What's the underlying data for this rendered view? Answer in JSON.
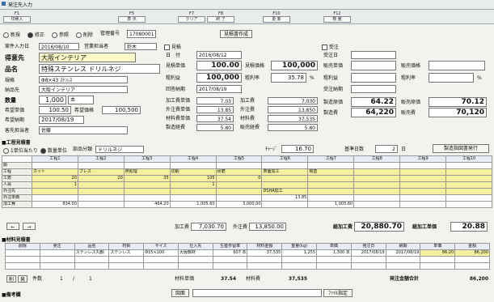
{
  "window": {
    "title": "発注先入力"
  },
  "fkeys": [
    {
      "key": "F1",
      "label": "印刷入"
    },
    {
      "key": "F5",
      "label": "表 示"
    },
    {
      "key": "F7",
      "label": "クリア"
    },
    {
      "key": "F8",
      "label": "終 了"
    },
    {
      "key": "F10",
      "label": "更 新"
    },
    {
      "key": "F12",
      "label": "検 索"
    }
  ],
  "mode": {
    "options": [
      "新規",
      "修正",
      "参照",
      "削除"
    ],
    "selected": "修正",
    "mgmt_label": "管理番号",
    "mgmt_value": "17080001",
    "quote_button": "見積書作成"
  },
  "left": {
    "order_date_label": "案件入力日",
    "order_date": "2016/08/10",
    "sales_label": "営業担当者",
    "sales": "鈴木",
    "customer_label": "得意先",
    "customer": "大阪インテリア",
    "product_label": "品名",
    "product": "特殊ステンレス ドリルネジ",
    "spec_label": "規格",
    "spec": "Φ8×43 ｽﾃﾝﾚｽ",
    "delivery_label": "納品先",
    "delivery": "大阪インテリア",
    "qty_label": "数量",
    "qty": "1,000",
    "qty_unit": "本",
    "price_label": "希望単価",
    "price": "100.50",
    "total_label": "希望価格",
    "total": "100,500",
    "due_label": "希望納期",
    "due": "2017/08/19",
    "person_label": "客先担当者",
    "person": "佐藤"
  },
  "quote": {
    "check_label": "見積",
    "date_label": "日　付",
    "date": "2016/08/12",
    "unit_label": "見積単価",
    "unit": "100.00",
    "price_label": "見積価格",
    "price": "100,000",
    "profit_label": "粗利益",
    "profit": "100,000",
    "rate_label": "粗利率",
    "rate": "35.78",
    "rate_unit": "%",
    "reply_label": "回答納期",
    "reply": "2017/08/19"
  },
  "order": {
    "check_label": "受注",
    "date_label": "受注日",
    "sale_unit_label": "販売単価",
    "sale_price_label": "販売価格",
    "profit_label": "粗利益",
    "rate_label": "粗利率",
    "rate_unit": "%",
    "due_label": "受注納期"
  },
  "costs": [
    {
      "l1": "加工費単価",
      "v1": "7.03",
      "l2": "加工費",
      "v2": "7,030"
    },
    {
      "l1": "外注費単価",
      "v1": "13.85",
      "l2": "外注費",
      "v2": "13,850"
    },
    {
      "l1": "材料費単価",
      "v1": "37.54",
      "l2": "材料費",
      "v2": "37,535"
    },
    {
      "l1": "製造経費",
      "v1": "5.80",
      "l2": "販売経費",
      "v2": "5.80"
    }
  ],
  "mfg": {
    "unit_label": "製造原価",
    "unit": "64.22",
    "sale_unit_label": "販売原価",
    "sale_unit": "70.12",
    "cost_label": "製造費",
    "cost": "64,220",
    "sale_cost_label": "販売費",
    "sale_cost": "70,120"
  },
  "process_section": {
    "title": "■工程見積書",
    "opt1": "1単位当たり",
    "opt2": "数量単位",
    "item_label": "部品分類",
    "item": "ドリルネジ",
    "charge_label": "ﾁｬｰｼﾞ",
    "charge": "16.70",
    "days_label": "基準日数",
    "days": "2",
    "days_unit": "日",
    "drawing_button": "製造指図書発行",
    "headers": [
      "工程1",
      "工程2",
      "工程3",
      "工程4",
      "工程5",
      "工程6",
      "工程7",
      "工程8",
      "工程9",
      "工程10"
    ],
    "row_labels": [
      "順",
      "工程",
      "工数",
      "人員",
      "外注先",
      "外注単価",
      "加工費"
    ],
    "procs": [
      "カット",
      "プレス",
      "熱処理",
      "切削",
      "研磨",
      "表面加工",
      "検査",
      "",
      "",
      ""
    ],
    "hours": [
      "20",
      "20",
      "35",
      "105",
      "0",
      "",
      "",
      "",
      "",
      ""
    ],
    "people": [
      "1",
      "",
      "",
      "1",
      "",
      "",
      "",
      "",
      "",
      ""
    ],
    "outsource": [
      "",
      "",
      "",
      "",
      "",
      "DSHA加工",
      "",
      "",
      "",
      ""
    ],
    "out_price": [
      "",
      "",
      "",
      "",
      "",
      "13.85",
      "",
      "",
      "",
      ""
    ],
    "proc_cost": [
      "834.00",
      "",
      "464.20",
      "1,005.60",
      "3,000.00",
      "",
      "1,005.60",
      "",
      "",
      "",
      ""
    ],
    "proc_total_label": "加工費",
    "proc_total": "7,030.70",
    "out_total_label": "外注費",
    "out_total": "13,850.00",
    "add_label": "総加工費",
    "add": "20,880.70",
    "add_unit_label": "総加工単価",
    "add_unit": "20.88"
  },
  "material": {
    "title": "■材料見積書",
    "headers": [
      "削除",
      "発注",
      "品名",
      "材質",
      "サイズ",
      "仕入先",
      "生産歩留率",
      "材料金額",
      "重量(kg)",
      "単価",
      "発注日",
      "納期",
      "単価",
      "金額"
    ],
    "row": [
      "",
      "",
      "ステンレス丸鋼",
      "ステンレス",
      "Φ15×100",
      "大阪鋼材",
      "607 本",
      "37,535",
      "1,255",
      "1,300 本",
      "2017/08/19",
      "2017/08/19",
      "86.20",
      "86,200"
    ],
    "count_label": "件数",
    "count": "1",
    "page": "1",
    "unit_label": "材料単価",
    "unit": "37.54",
    "cost_label": "材料費",
    "cost": "37,535",
    "order_total_label": "発注金額合計",
    "order_total": "86,200"
  },
  "notes": {
    "title": "■備考欄",
    "ref_label": "図面",
    "ref_button": "ﾌｧｲﾙ指定"
  }
}
